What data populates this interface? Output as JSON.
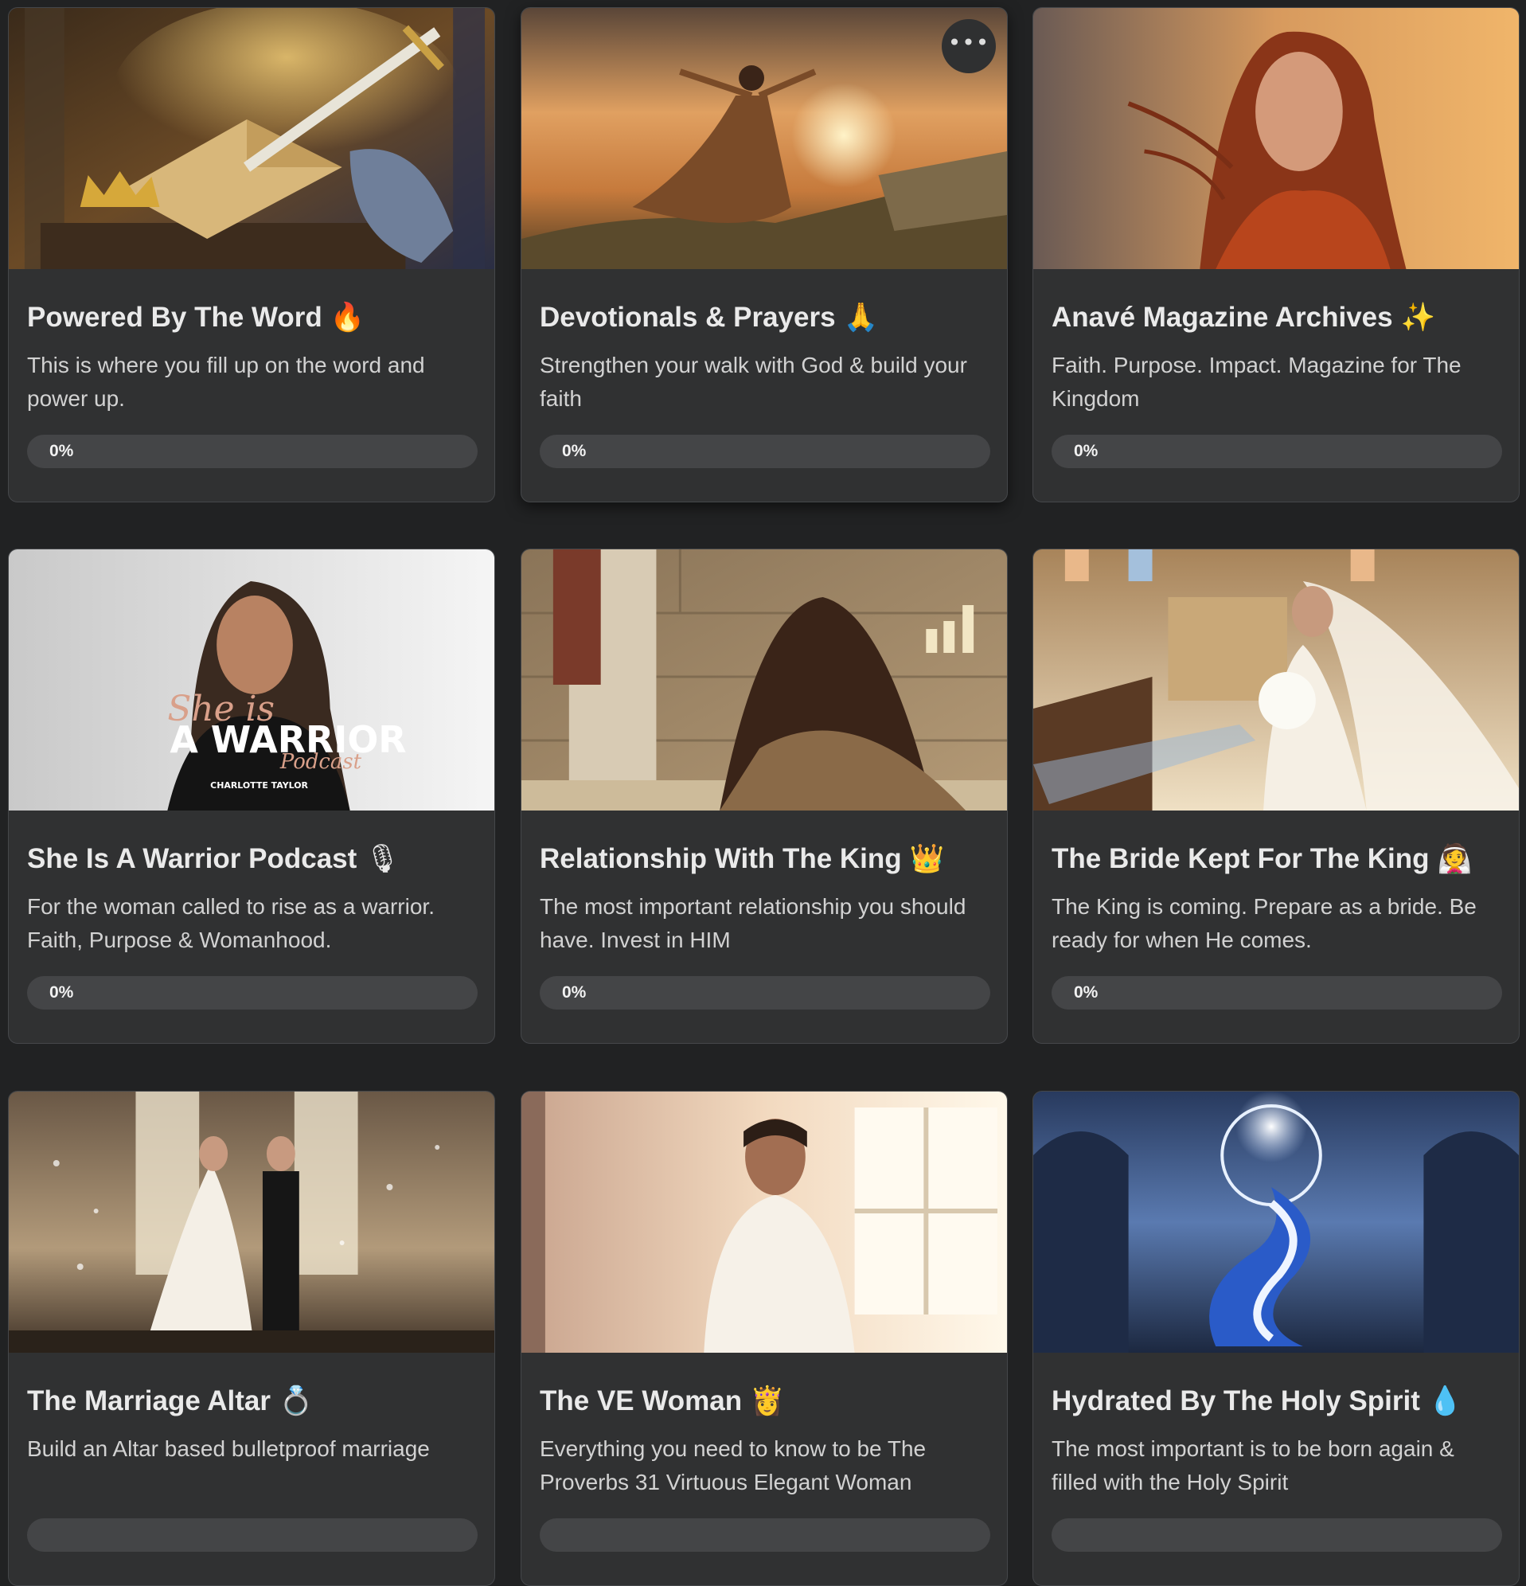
{
  "cards": [
    {
      "title": "Powered By The Word",
      "emoji": "🔥",
      "description": "This is where you fill up on the word and power up.",
      "progress_label": "0%",
      "progress": 0
    },
    {
      "title": "Devotionals & Prayers",
      "emoji": "🙏",
      "description": "Strengthen your walk with God & build your faith",
      "progress_label": "0%",
      "progress": 0
    },
    {
      "title": "Anavé Magazine Archives",
      "emoji": "✨",
      "description": "Faith. Purpose. Impact. Magazine for The Kingdom",
      "progress_label": "0%",
      "progress": 0
    },
    {
      "title": "She Is A Warrior Podcast",
      "emoji": "🎙",
      "description": "For the woman called to rise as a warrior. Faith, Purpose & Womanhood.",
      "progress_label": "0%",
      "progress": 0
    },
    {
      "title": "Relationship With The King",
      "emoji": "👑",
      "description": "The most important relationship you should have. Invest in HIM",
      "progress_label": "0%",
      "progress": 0
    },
    {
      "title": "The Bride Kept For The King",
      "emoji": "👰",
      "description": "The King is coming. Prepare as a bride. Be ready for when He comes.",
      "progress_label": "0%",
      "progress": 0
    },
    {
      "title": "The Marriage Altar",
      "emoji": "💍",
      "description": "Build an Altar based bulletproof marriage"
    },
    {
      "title": "The VE Woman",
      "emoji": "👸",
      "description": "Everything you need to know to be The Proverbs 31 Virtuous Elegant Woman"
    },
    {
      "title": "Hydrated By The Holy Spirit",
      "emoji": "💧",
      "description": "The most important is to be born again & filled with the Holy Spirit"
    }
  ],
  "podcast_cover": {
    "line1": "She is",
    "line2": "A WARRIOR",
    "line3": "Podcast",
    "author": "CHARLOTTE TAYLOR"
  },
  "more_button": "•••"
}
